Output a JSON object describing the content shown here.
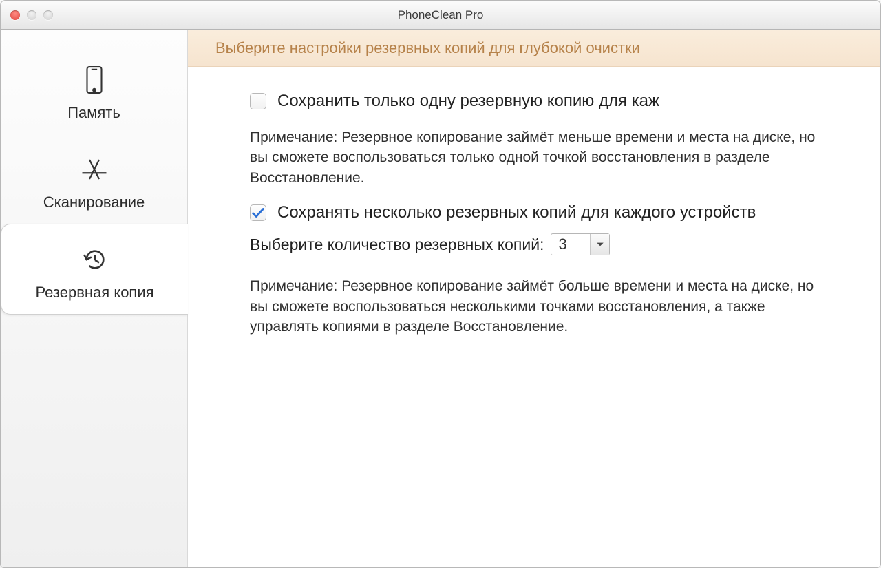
{
  "window": {
    "title": "PhoneClean Pro"
  },
  "sidebar": {
    "items": [
      {
        "label": "Память"
      },
      {
        "label": "Сканирование"
      },
      {
        "label": "Резервная копия"
      }
    ]
  },
  "content": {
    "banner": "Выберите настройки резервных копий для глубокой очистки",
    "option1": {
      "label": "Сохранить только одну резервную копию для каж",
      "checked": false,
      "note": "Примечание: Резервное копирование займёт меньше времени и места на диске, но вы сможете воспользоваться только одной точкой восстановления в разделе Восстановление."
    },
    "option2": {
      "label": "Сохранять несколько резервных копий для каждого устройств",
      "checked": true,
      "qty_label": "Выберите количество резервных копий:",
      "qty_value": "3",
      "note": "Примечание: Резервное копирование займёт больше времени и места на диске, но вы сможете воспользоваться несколькими точками восстановления, а также управлять копиями в разделе Восстановление."
    }
  }
}
